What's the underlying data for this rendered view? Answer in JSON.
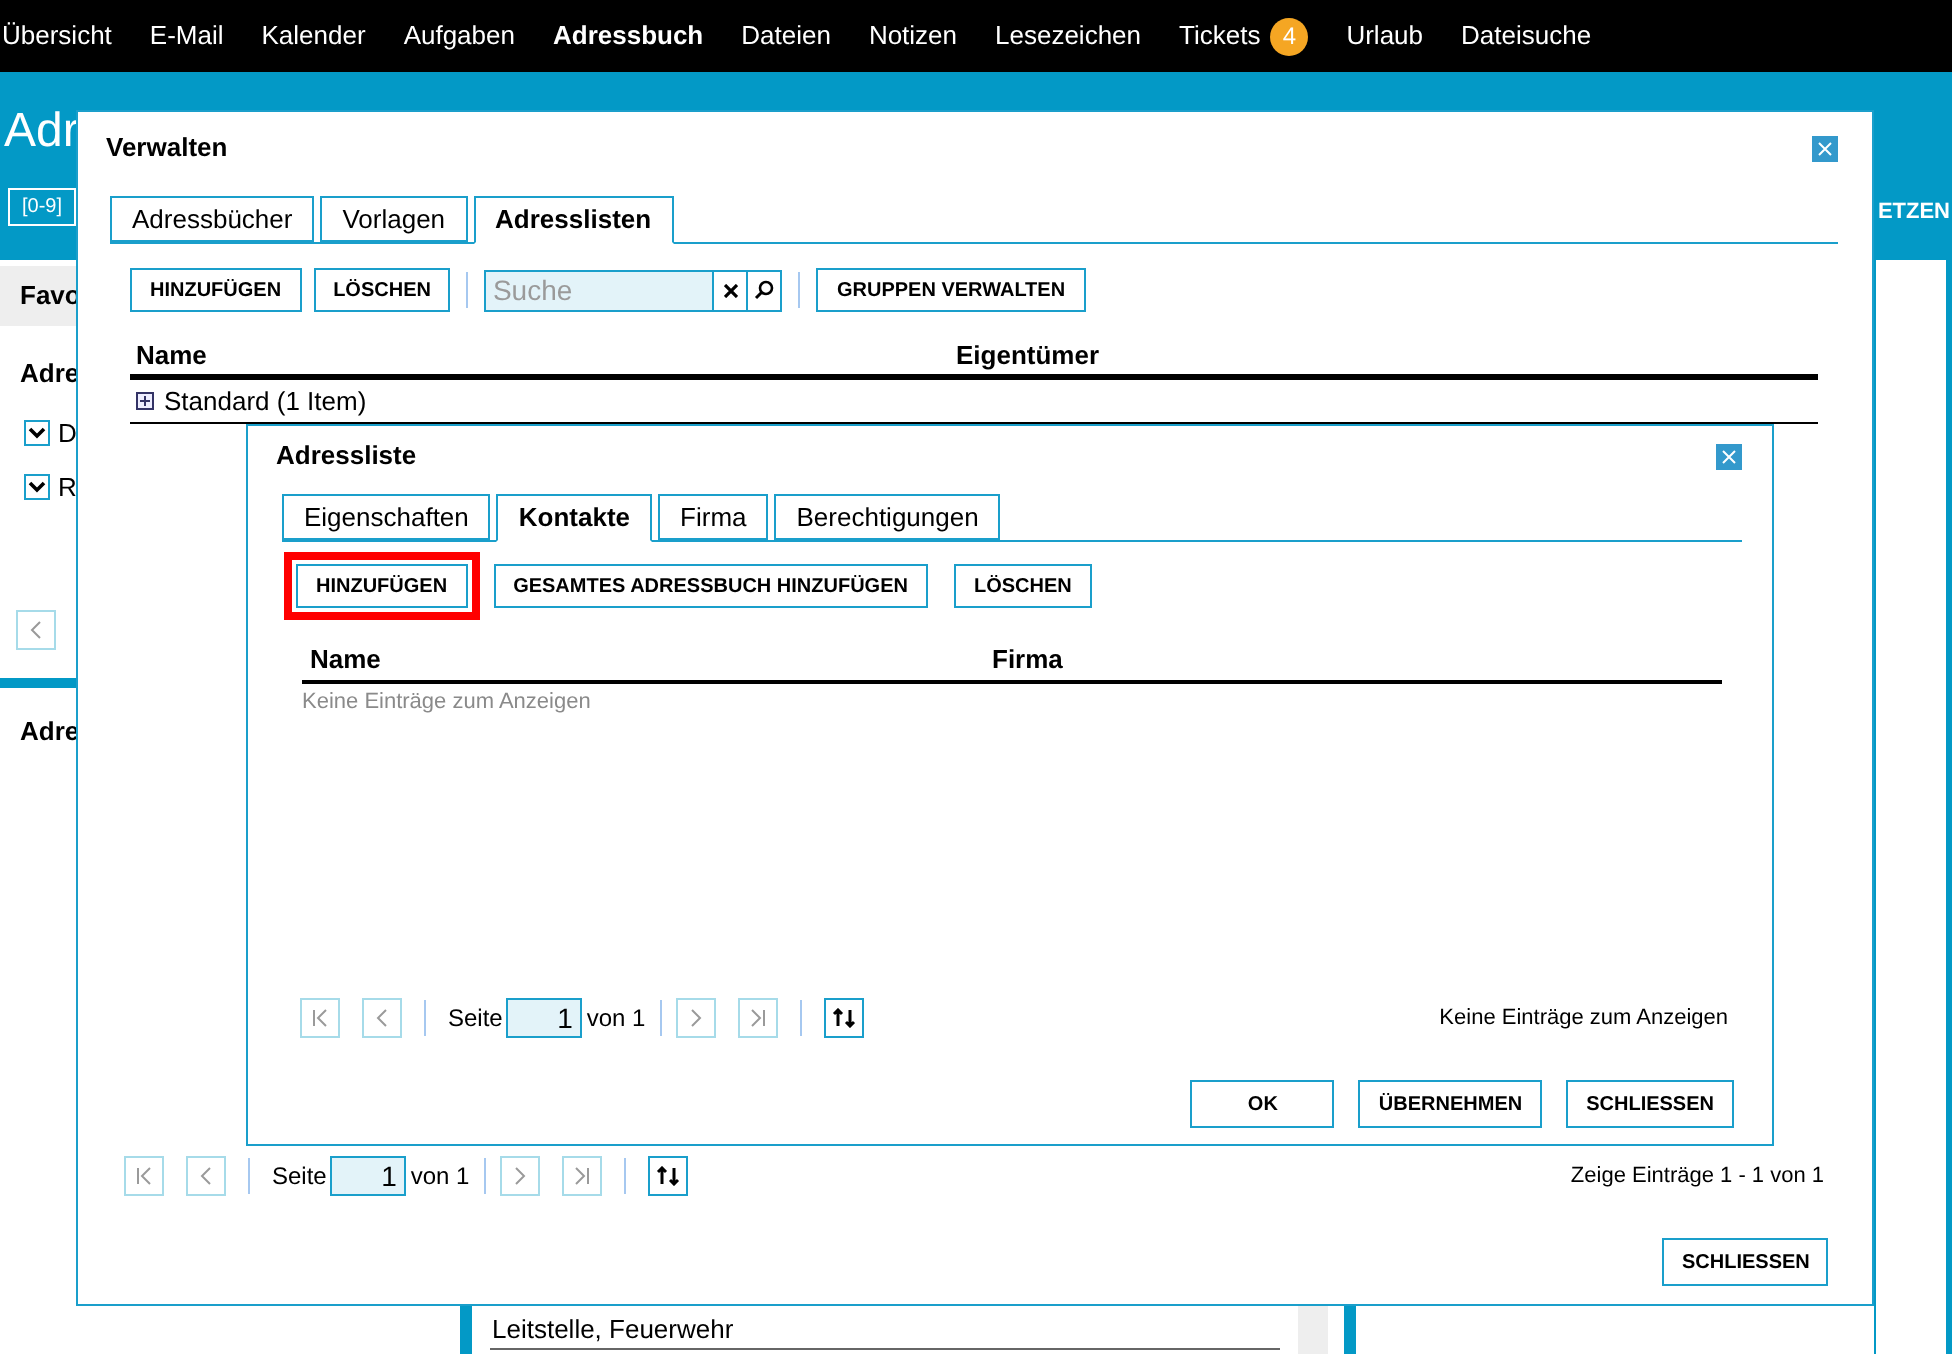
{
  "nav": [
    {
      "label": "Übersicht",
      "selected": false
    },
    {
      "label": "E-Mail",
      "selected": false
    },
    {
      "label": "Kalender",
      "selected": false
    },
    {
      "label": "Aufgaben",
      "selected": false
    },
    {
      "label": "Adressbuch",
      "selected": true
    },
    {
      "label": "Dateien",
      "selected": false
    },
    {
      "label": "Notizen",
      "selected": false
    },
    {
      "label": "Lesezeichen",
      "selected": false
    },
    {
      "label": "Tickets",
      "selected": false,
      "badge": "4"
    },
    {
      "label": "Urlaub",
      "selected": false
    },
    {
      "label": "Dateisuche",
      "selected": false
    }
  ],
  "background": {
    "title": "Adr",
    "index_button": "[0-9]",
    "header_action": "ETZEN",
    "favorites_label": "Favo",
    "section_label": "Adre",
    "checkboxes": [
      {
        "label": "D",
        "checked": true
      },
      {
        "label": "R",
        "checked": true
      }
    ],
    "lower_section_label": "Adre",
    "list_items": [
      "Leitstelle, Feuerwehr"
    ]
  },
  "manage_dialog": {
    "title": "Verwalten",
    "tabs": [
      {
        "label": "Adressbücher",
        "selected": false
      },
      {
        "label": "Vorlagen",
        "selected": false
      },
      {
        "label": "Adresslisten",
        "selected": true
      }
    ],
    "toolbar": {
      "buttons": [
        "HINZUFÜGEN",
        "LÖSCHEN"
      ],
      "search": {
        "placeholder": "Suche"
      },
      "group_button": "GRUPPEN VERWALTEN"
    },
    "table": {
      "columns": [
        "Name",
        "Eigentümer"
      ],
      "rows": [
        {
          "name": "Standard (1 Item)",
          "expanded": false
        }
      ]
    },
    "pager": {
      "nav_disabled": true,
      "page_label": "Seite",
      "page": "1",
      "total_label": "von 1"
    },
    "summary": "Zeige Einträge 1 - 1 von 1",
    "close_button": "SCHLIESSEN"
  },
  "list_dialog": {
    "title": "Adressliste",
    "tabs": [
      {
        "label": "Eigenschaften",
        "selected": false
      },
      {
        "label": "Kontakte",
        "selected": true
      },
      {
        "label": "Firma",
        "selected": false
      },
      {
        "label": "Berechtigungen",
        "selected": false
      }
    ],
    "buttons": [
      {
        "label": "HINZUFÜGEN",
        "highlighted": true
      },
      {
        "label": "GESAMTES ADRESSBUCH HINZUFÜGEN",
        "highlighted": false
      },
      {
        "label": "LÖSCHEN",
        "highlighted": false
      }
    ],
    "table": {
      "columns": [
        "Name",
        "Firma"
      ],
      "empty_text": "Keine Einträge zum Anzeigen"
    },
    "pager": {
      "nav_disabled": true,
      "page_label": "Seite",
      "page": "1",
      "total_label": "von 1"
    },
    "summary": "Keine Einträge zum Anzeigen",
    "footer_buttons": [
      "OK",
      "ÜBERNEHMEN",
      "SCHLIESSEN"
    ]
  }
}
